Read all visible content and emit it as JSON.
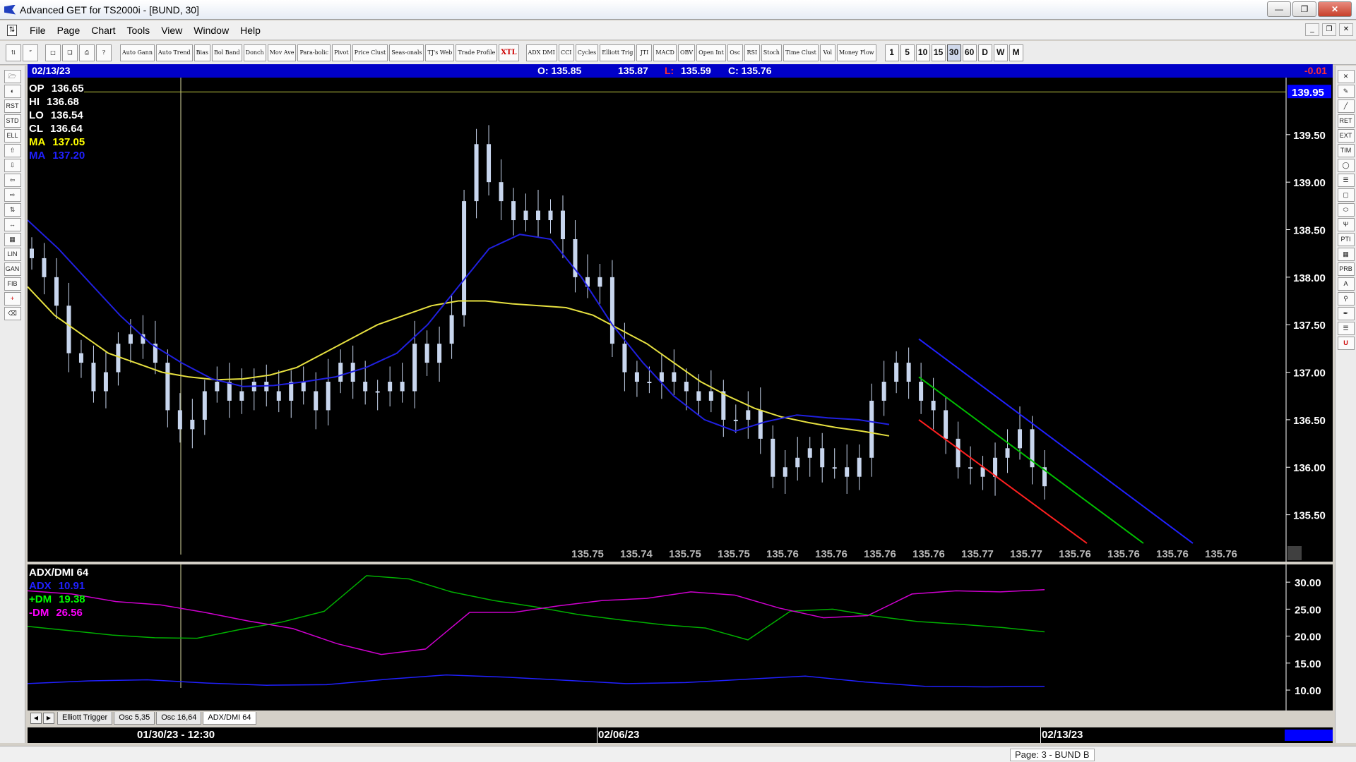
{
  "window": {
    "title": "Advanced GET for TS2000i - [BUND, 30]"
  },
  "menu": [
    "File",
    "Page",
    "Chart",
    "Tools",
    "View",
    "Window",
    "Help"
  ],
  "toolbar": {
    "study_buttons": [
      "Auto Gann",
      "Auto Trend",
      "Bias",
      "Bol Band",
      "Donch",
      "Mov Ave",
      "Para-bolic",
      "Pivot",
      "Price Clust",
      "Seas-onals",
      "TJ's Web",
      "Trade Profile",
      "XTL",
      "ADX DMI",
      "CCI",
      "Cycles",
      "Elliott Trig",
      "JTI",
      "MACD",
      "OBV",
      "Open Int",
      "Osc",
      "RSI",
      "Stoch",
      "Time Clust",
      "Vol",
      "Money Flow"
    ],
    "timeframes": [
      "1",
      "5",
      "10",
      "15",
      "30",
      "60",
      "D",
      "W",
      "M"
    ],
    "active_timeframe": "30"
  },
  "status_strip": {
    "date": "02/13/23",
    "open": "O: 135.85",
    "high": "135.87",
    "low_label": "L:",
    "low": "135.59",
    "close": "C: 135.76",
    "change": "-0.01"
  },
  "info_panel": [
    {
      "label": "OP",
      "value": "136.65",
      "color": "#ffffff"
    },
    {
      "label": "HI",
      "value": "136.68",
      "color": "#ffffff"
    },
    {
      "label": "LO",
      "value": "136.54",
      "color": "#ffffff"
    },
    {
      "label": "CL",
      "value": "136.64",
      "color": "#ffffff"
    },
    {
      "label": "MA",
      "value": "137.05",
      "color": "#ffff00"
    },
    {
      "label": "MA",
      "value": "137.20",
      "color": "#2020ff"
    }
  ],
  "price_axis": {
    "current_price_label": "139.95",
    "ticks": [
      "139.50",
      "139.00",
      "138.50",
      "138.00",
      "137.50",
      "137.00",
      "136.50",
      "136.00",
      "135.50"
    ],
    "forecast_label": "135.76",
    "bottom_values": [
      "135.75",
      "135.74",
      "135.75",
      "135.75",
      "135.76",
      "135.76",
      "135.76",
      "135.76",
      "135.77",
      "135.77",
      "135.76",
      "135.76",
      "135.76",
      "135.76"
    ]
  },
  "indicator": {
    "title": "ADX/DMI 64",
    "adx": {
      "label": "ADX",
      "value": "10.91",
      "color": "#2020ff"
    },
    "plus_dm": {
      "label": "+DM",
      "value": "19.38",
      "color": "#00ff00"
    },
    "minus_dm": {
      "label": "-DM",
      "value": "26.56",
      "color": "#ff00ff"
    },
    "axis_ticks": [
      "30.00",
      "25.00",
      "20.00",
      "15.00",
      "10.00"
    ]
  },
  "tabs": [
    "Elliott Trigger",
    "Osc 5,35",
    "Osc 16,64",
    "ADX/DMI 64"
  ],
  "active_tab": "ADX/DMI 64",
  "date_axis": {
    "labels": [
      "01/30/23 - 12:30",
      "02/06/23",
      "02/13/23"
    ]
  },
  "statusbar": {
    "page": "Page: 3 - BUND B"
  },
  "chart_data": {
    "type": "line",
    "price_range": [
      135.2,
      140.1
    ],
    "bar_closes": [
      138.2,
      138.0,
      137.7,
      137.2,
      137.1,
      136.8,
      137.0,
      137.3,
      137.4,
      137.3,
      137.1,
      136.6,
      136.4,
      136.5,
      136.8,
      136.9,
      136.7,
      136.8,
      136.9,
      136.8,
      136.7,
      136.9,
      136.8,
      136.6,
      136.9,
      137.1,
      136.9,
      136.8,
      136.8,
      136.9,
      136.8,
      137.3,
      137.1,
      137.3,
      137.6,
      138.8,
      139.4,
      139.0,
      138.8,
      138.6,
      138.7,
      138.6,
      138.7,
      138.4,
      138.0,
      137.9,
      138.0,
      137.3,
      137.0,
      136.9,
      136.9,
      137.0,
      136.9,
      136.8,
      136.7,
      136.8,
      136.5,
      136.5,
      136.6,
      136.3,
      135.9,
      136.0,
      136.1,
      136.2,
      136.0,
      136.0,
      135.9,
      136.1,
      136.7,
      136.9,
      137.1,
      136.9,
      136.7,
      136.6,
      136.3,
      136.0,
      136.0,
      135.9,
      136.1,
      136.2,
      136.4,
      136.0,
      135.8
    ],
    "moving_average_fast": [
      137.9,
      137.6,
      137.4,
      137.2,
      137.1,
      137.0,
      136.95,
      136.92,
      136.93,
      136.97,
      137.05,
      137.2,
      137.35,
      137.5,
      137.6,
      137.7,
      137.75,
      137.75,
      137.72,
      137.7,
      137.68,
      137.6,
      137.45,
      137.3,
      137.1,
      136.9,
      136.75,
      136.62,
      136.53,
      136.47,
      136.42,
      136.38,
      136.33
    ],
    "moving_average_slow": [
      138.6,
      138.3,
      137.95,
      137.6,
      137.3,
      137.1,
      136.93,
      136.85,
      136.86,
      136.9,
      136.95,
      137.05,
      137.2,
      137.5,
      137.9,
      138.3,
      138.45,
      138.4,
      138.0,
      137.5,
      137.1,
      136.75,
      136.5,
      136.38,
      136.48,
      136.55,
      136.52,
      136.5,
      136.45
    ],
    "adx": [
      11.2,
      11.7,
      11.9,
      11.3,
      10.9,
      11.0,
      12.0,
      12.8,
      12.4,
      11.8,
      11.2,
      11.4,
      12.0,
      12.6,
      11.5,
      10.7,
      10.6,
      10.7
    ],
    "plus_dm": [
      21.8,
      21.0,
      20.2,
      19.7,
      19.6,
      21.2,
      22.6,
      24.6,
      31.2,
      30.6,
      28.2,
      26.6,
      25.4,
      24.0,
      23.0,
      22.1,
      21.5,
      19.3,
      24.6,
      25.0,
      23.7,
      22.7,
      22.2,
      21.6,
      20.8
    ],
    "minus_dm": [
      28.4,
      27.8,
      26.4,
      25.8,
      24.4,
      22.8,
      21.4,
      18.6,
      16.6,
      17.6,
      24.4,
      24.4,
      25.6,
      26.6,
      27.0,
      28.2,
      27.6,
      25.2,
      23.4,
      23.8,
      27.8,
      28.4,
      28.2,
      28.6
    ]
  }
}
